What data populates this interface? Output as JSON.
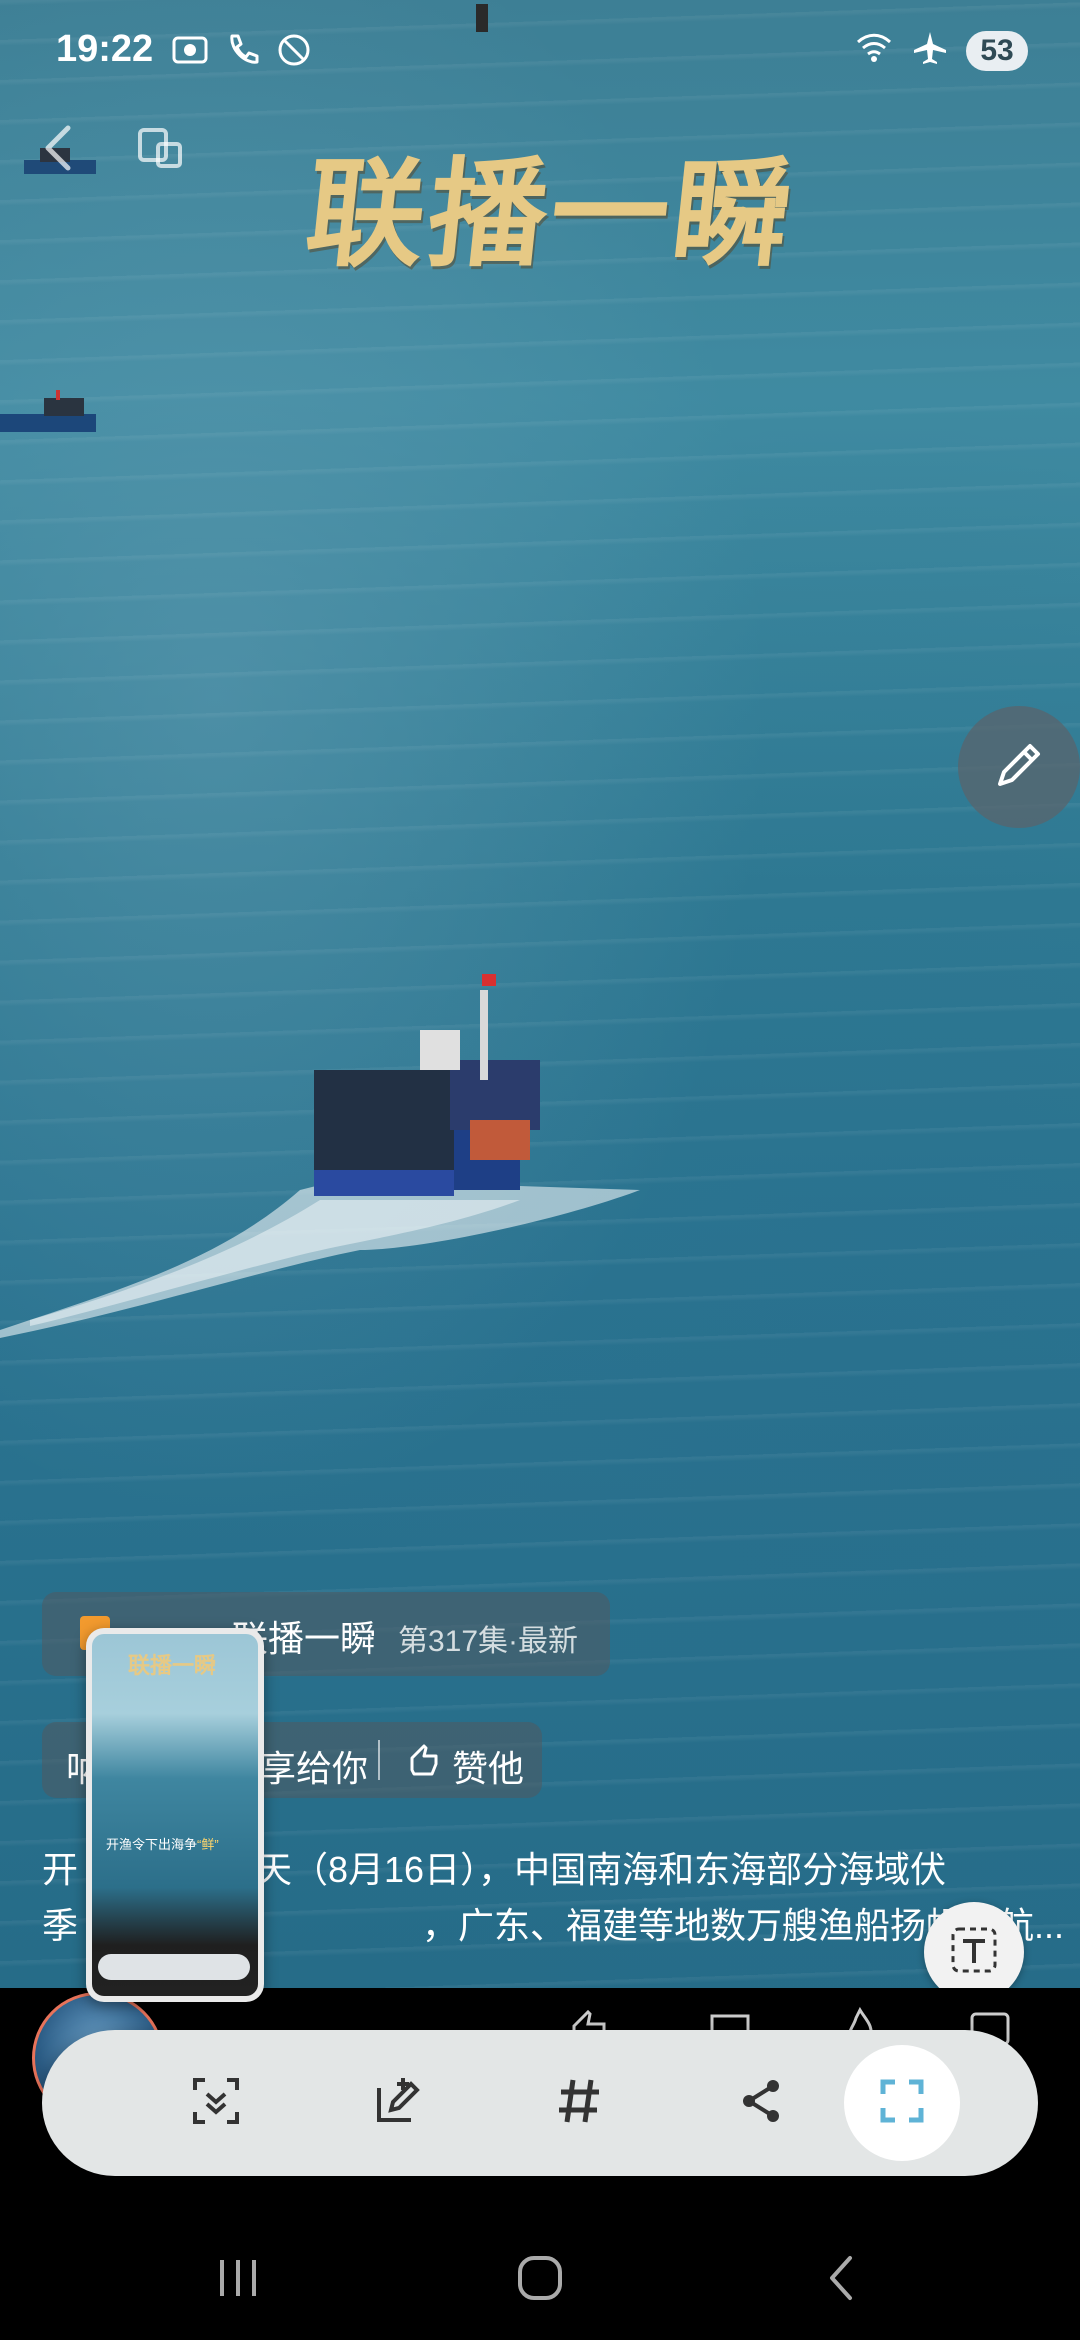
{
  "status_bar": {
    "time": "19:22",
    "battery": "53",
    "icons_left": [
      "screen-record-icon",
      "call-icon",
      "blocked-icon"
    ],
    "icons_right": [
      "wifi-icon",
      "airplane-icon"
    ]
  },
  "video": {
    "title": "联播一瞬"
  },
  "series": {
    "name": "联播一瞬",
    "episode": "第317集·最新"
  },
  "share_bar": {
    "prefix": "呐",
    "share_text": "享给你",
    "like_text": "赞他"
  },
  "description": {
    "line1_start": "开",
    "line1_rest": "天（8月16日），中国南海和东海部分海域伏",
    "line2_start": "季",
    "line2_rest": "，广东、福建等地数万艘渔船扬帆起航..."
  },
  "thumbnail": {
    "title": "联播一瞬",
    "caption_main": "开渔令下出海争",
    "caption_highlight": "“鲜”"
  },
  "toolbar": {
    "buttons": [
      "smart-select-icon",
      "draw-edit-icon",
      "hashtag-icon",
      "share-icon",
      "capture-icon"
    ]
  },
  "navbar": {
    "buttons": [
      "recent-apps-icon",
      "home-icon",
      "back-icon"
    ]
  },
  "colors": {
    "title_gold": "#e6c985",
    "accent_capture": "#5fb3d6",
    "toolbar_bg": "#e3e6e6"
  }
}
